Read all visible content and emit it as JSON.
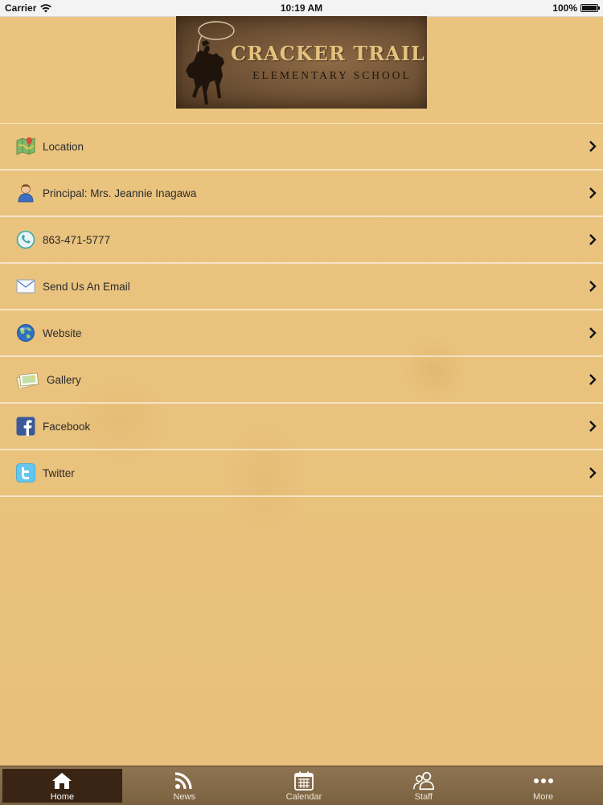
{
  "status_bar": {
    "carrier": "Carrier",
    "time": "10:19 AM",
    "battery": "100%"
  },
  "header": {
    "logo_title": "CRACKER TRAIL",
    "logo_subtitle": "ELEMENTARY SCHOOL"
  },
  "menu": {
    "items": [
      {
        "label": "Location",
        "icon": "map-icon"
      },
      {
        "label": "Principal: Mrs. Jeannie Inagawa",
        "icon": "person-icon"
      },
      {
        "label": "863-471-5777",
        "icon": "phone-icon"
      },
      {
        "label": "Send Us An Email",
        "icon": "email-icon"
      },
      {
        "label": "Website",
        "icon": "globe-icon"
      },
      {
        "label": "Gallery",
        "icon": "gallery-icon"
      },
      {
        "label": "Facebook",
        "icon": "facebook-icon"
      },
      {
        "label": "Twitter",
        "icon": "twitter-icon"
      }
    ]
  },
  "tab_bar": {
    "tabs": [
      {
        "label": "Home",
        "icon": "home-icon",
        "active": true
      },
      {
        "label": "News",
        "icon": "rss-icon",
        "active": false
      },
      {
        "label": "Calendar",
        "icon": "calendar-icon",
        "active": false
      },
      {
        "label": "Staff",
        "icon": "staff-icon",
        "active": false
      },
      {
        "label": "More",
        "icon": "more-icon",
        "active": false
      }
    ]
  },
  "colors": {
    "background": "#e9c27e",
    "tab_bar": "#8e7452",
    "tab_active": "#3a2414",
    "logo_text": "#e3c27e"
  }
}
